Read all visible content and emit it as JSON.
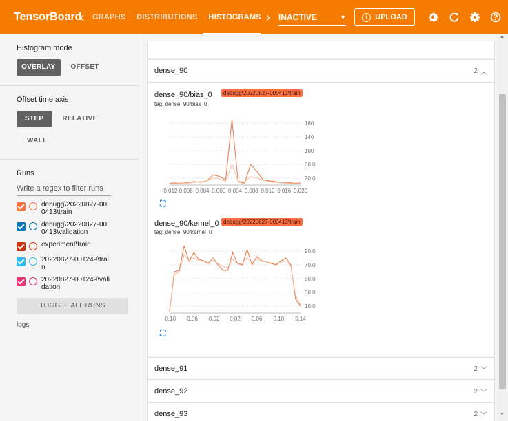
{
  "app": {
    "title": "TensorBoard"
  },
  "tabs": [
    "GRAPHS",
    "DISTRIBUTIONS",
    "HISTOGRAMS",
    "TI"
  ],
  "active_tab": "HISTOGRAMS",
  "plugin_select": {
    "value": "INACTIVE"
  },
  "upload": {
    "label": "UPLOAD"
  },
  "sidebar": {
    "histogram_mode": {
      "title": "Histogram mode",
      "options": [
        "OVERLAY",
        "OFFSET"
      ],
      "selected": "OVERLAY"
    },
    "offset_time_axis": {
      "title": "Offset time axis",
      "options": [
        "STEP",
        "RELATIVE",
        "WALL"
      ],
      "selected": "STEP"
    },
    "runs": {
      "title": "Runs",
      "filter_placeholder": "Write a regex to filter runs",
      "items": [
        {
          "label": "debugg\\20220827-000413\\train",
          "checked": true,
          "color": "#ff7043"
        },
        {
          "label": "debugg\\20220827-000413\\validation",
          "checked": true,
          "color": "#0077bb"
        },
        {
          "label": "experiment\\train",
          "checked": true,
          "color": "#cc3311"
        },
        {
          "label": "20220827-001249\\train",
          "checked": true,
          "color": "#33bbee"
        },
        {
          "label": "20220827-001249\\validation",
          "checked": true,
          "color": "#ee3377"
        }
      ],
      "toggle_label": "TOGGLE ALL RUNS",
      "logdir": "logs"
    }
  },
  "groups": [
    {
      "name": "dense_90",
      "count": "2",
      "expanded": true
    },
    {
      "name": "dense_91",
      "count": "2",
      "expanded": false
    },
    {
      "name": "dense_92",
      "count": "2",
      "expanded": false
    },
    {
      "name": "dense_93",
      "count": "2",
      "expanded": false
    }
  ],
  "charts": [
    {
      "title": "dense_90/bias_0",
      "run": "debugg\\20220827-000413\\train",
      "tag": "tag: dense_90/bias_0",
      "chart_data": {
        "type": "line",
        "x_ticks": [
          "-0.012",
          "0.008",
          "0.004",
          "0.000",
          "0.004",
          "0.008",
          "0.012",
          "0.016",
          "0.020"
        ],
        "y_ticks": [
          "180",
          "140",
          "100",
          "60.0",
          "20.0"
        ],
        "ylim": [
          0,
          200
        ],
        "series": [
          {
            "values": [
              5,
              6,
              5,
              8,
              10,
              8,
              12,
              30,
              25,
              15,
              190,
              10,
              5,
              60,
              40,
              15,
              12,
              10,
              6,
              8,
              5,
              6
            ]
          },
          {
            "values": [
              3,
              4,
              6,
              5,
              8,
              10,
              12,
              20,
              18,
              10,
              60,
              12,
              8,
              25,
              20,
              14,
              10,
              8,
              6,
              5,
              4,
              4
            ]
          }
        ]
      }
    },
    {
      "title": "dense_90/kernel_0",
      "run": "debugg\\20220827-000413\\train",
      "tag": "tag: dense_90/kernel_0",
      "chart_data": {
        "type": "line",
        "x_ticks": [
          "-0.10",
          "-0.06",
          "-0.02",
          "0.02",
          "0.06",
          "0.10",
          "0.14"
        ],
        "y_ticks": [
          "90.0",
          "70.0",
          "50.0",
          "30.0",
          "10.0"
        ],
        "ylim": [
          0,
          100
        ],
        "series": [
          {
            "values": [
              2,
              60,
              62,
              98,
              75,
              88,
              78,
              76,
              72,
              80,
              70,
              62,
              62,
              88,
              72,
              70,
              92,
              70,
              82,
              76,
              74,
              72,
              70,
              76,
              80,
              70,
              20,
              10
            ]
          },
          {
            "values": [
              5,
              55,
              60,
              85,
              76,
              80,
              76,
              75,
              74,
              76,
              72,
              68,
              66,
              78,
              72,
              72,
              80,
              74,
              78,
              75,
              74,
              73,
              72,
              74,
              76,
              68,
              25,
              12
            ]
          }
        ]
      }
    }
  ]
}
